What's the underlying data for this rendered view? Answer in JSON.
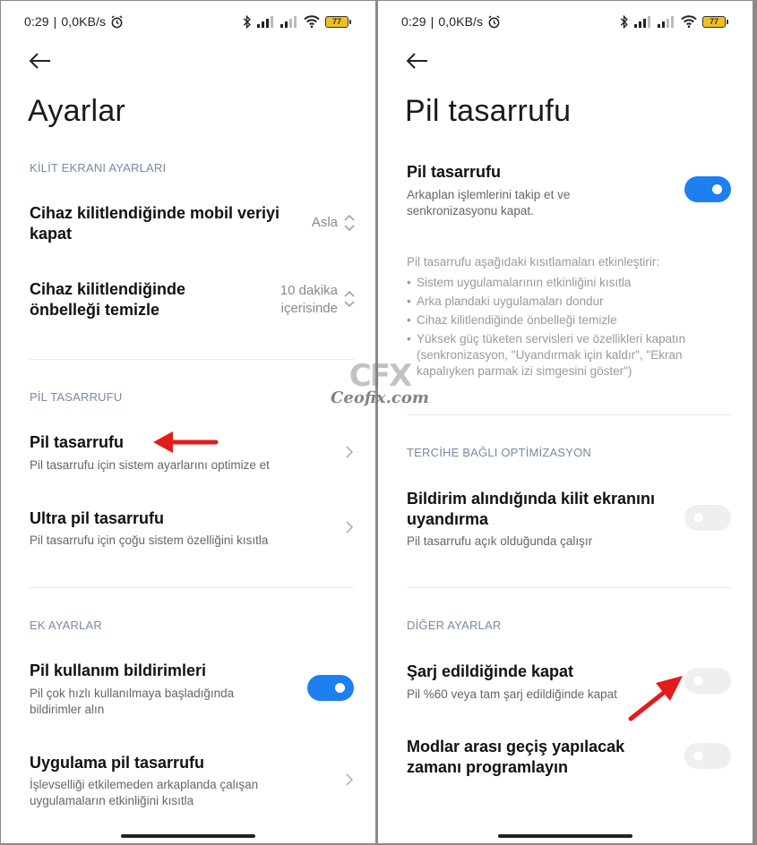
{
  "status": {
    "time": "0:29",
    "separator": "|",
    "net_speed": "0,0KB/s",
    "battery": "77"
  },
  "left": {
    "title": "Ayarlar",
    "lock_section": "KİLİT EKRANI AYARLARI",
    "mobile_data": {
      "title": "Cihaz kilitlendiğinde mobil veriyi kapat",
      "value": "Asla"
    },
    "clear_cache": {
      "title": "Cihaz kilitlendiğinde önbelleği temizle",
      "value": "10 dakika içerisinde"
    },
    "battery_section": "PİL TASARRUFU",
    "battery_saver": {
      "title": "Pil tasarrufu",
      "subtitle": "Pil tasarrufu için sistem ayarlarını optimize et"
    },
    "ultra_saver": {
      "title": "Ultra pil tasarrufu",
      "subtitle": "Pil tasarrufu için çoğu sistem özelliğini kısıtla"
    },
    "extra_section": "EK AYARLAR",
    "usage_notifications": {
      "title": "Pil kullanım bildirimleri",
      "subtitle": "Pil çok hızlı kullanılmaya başladığında bildirimler alın",
      "enabled": true
    },
    "app_saver": {
      "title": "Uygulama pil tasarrufu",
      "subtitle": "İşlevselliği etkilemeden arkaplanda çalışan uygulamaların etkinliğini kısıtla"
    }
  },
  "right": {
    "title": "Pil tasarrufu",
    "saver_toggle": {
      "title": "Pil tasarrufu",
      "subtitle": "Arkaplan işlemlerini takip et ve senkronizasyonu kapat.",
      "enabled": true
    },
    "info_intro": "Pil tasarrufu aşağıdaki kısıtlamaları etkinleştirir:",
    "info_items": [
      "Sistem uygulamalarının etkinliğini kısıtla",
      "Arka plandaki uygulamaları dondur",
      "Cihaz kilitlendiğinde önbelleği temizle",
      "Yüksek güç tüketen servisleri ve özellikleri kapatın (senkronizasyon, \"Uyandırmak için kaldır\", \"Ekran kapalıyken parmak izi simgesini göster\")"
    ],
    "optional_section": "TERCİHE BAĞLI OPTİMİZASYON",
    "no_wake": {
      "title": "Bildirim alındığında kilit ekranını uyandırma",
      "subtitle": "Pil tasarrufu açık olduğunda çalışır",
      "enabled": false
    },
    "other_section": "DİĞER AYARLAR",
    "charge_off": {
      "title": "Şarj edildiğinde kapat",
      "subtitle": "Pil %60 veya tam şarj edildiğinde kapat",
      "enabled": false
    },
    "schedule": {
      "title": "Modlar arası geçiş yapılacak zamanı programlayın",
      "enabled": false
    }
  },
  "watermark": {
    "logo": "CFX",
    "text": "Ceofix.com"
  },
  "colors": {
    "accent": "#1e7ff0",
    "section": "#7b88a3",
    "arrow": "#e31b1b"
  }
}
